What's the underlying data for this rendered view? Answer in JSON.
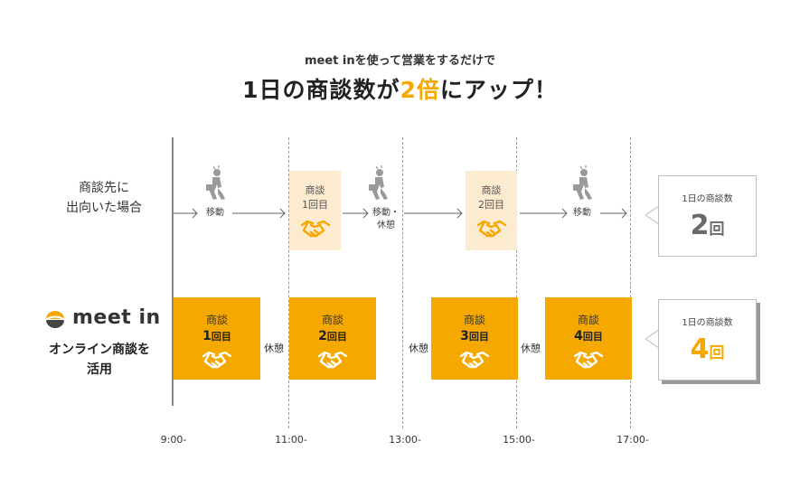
{
  "header": {
    "subtitle": "meet inを使って営業をするだけで",
    "headline_prefix": "1日の商談数が",
    "headline_highlight": "2倍",
    "headline_suffix": "にアップ！"
  },
  "row_offline": {
    "label_line1": "商談先に",
    "label_line2": "出向いた場合",
    "move_label": "移動",
    "move_rest_line1": "移動・",
    "move_rest_line2": "休憩",
    "meetings": [
      {
        "title": "商談",
        "count": "1回目"
      },
      {
        "title": "商談",
        "count": "2回目"
      }
    ],
    "callout": {
      "caption": "1日の商談数",
      "number": "2",
      "unit": "回"
    }
  },
  "row_online": {
    "brand": "meet in",
    "label_line1": "オンライン商談を",
    "label_line2": "活用",
    "rest_label": "休憩",
    "meetings": [
      {
        "title": "商談",
        "num": "1",
        "unit": "回目"
      },
      {
        "title": "商談",
        "num": "2",
        "unit": "回目"
      },
      {
        "title": "商談",
        "num": "3",
        "unit": "回目"
      },
      {
        "title": "商談",
        "num": "4",
        "unit": "回目"
      }
    ],
    "callout": {
      "caption": "1日の商談数",
      "number": "4",
      "unit": "回"
    }
  },
  "time_axis": [
    "9:00-",
    "11:00-",
    "13:00-",
    "15:00-",
    "17:00-"
  ],
  "colors": {
    "accent": "#f5a800",
    "pale_accent": "#fdebcf",
    "axis": "#888888",
    "text": "#333333"
  },
  "icons": [
    "walking-businessman-icon",
    "handshake-icon",
    "arrow-right-icon",
    "meet-in-logo-icon"
  ]
}
